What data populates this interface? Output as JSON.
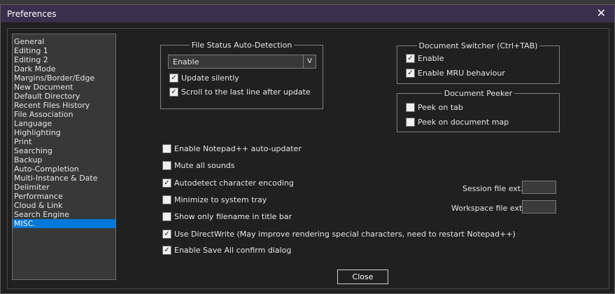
{
  "window": {
    "title": "Preferences",
    "close_glyph": "✕"
  },
  "categories": [
    "General",
    "Editing 1",
    "Editing 2",
    "Dark Mode",
    "Margins/Border/Edge",
    "New Document",
    "Default Directory",
    "Recent Files History",
    "File Association",
    "Language",
    "Highlighting",
    "Print",
    "Searching",
    "Backup",
    "Auto-Completion",
    "Multi-Instance & Date",
    "Delimiter",
    "Performance",
    "Cloud & Link",
    "Search Engine",
    "MISC."
  ],
  "selected_category": "MISC.",
  "file_status": {
    "legend": "File Status Auto-Detection",
    "select_value": "Enable",
    "select_arrow": "V",
    "update_silently": {
      "label": "Update silently",
      "checked": true
    },
    "scroll_last_line": {
      "label": "Scroll to the last line after update",
      "checked": true
    }
  },
  "doc_switcher": {
    "legend": "Document Switcher (Ctrl+TAB)",
    "enable": {
      "label": "Enable",
      "checked": true
    },
    "mru": {
      "label": "Enable MRU behaviour",
      "checked": true
    }
  },
  "doc_peeker": {
    "legend": "Document Peeker",
    "peek_tab": {
      "label": "Peek on tab",
      "checked": false
    },
    "peek_map": {
      "label": "Peek on document map",
      "checked": false
    }
  },
  "misc": {
    "auto_updater": {
      "label": "Enable Notepad++ auto-updater",
      "checked": false
    },
    "mute": {
      "label": "Mute all sounds",
      "checked": false
    },
    "autodetect_encoding": {
      "label": "Autodetect character encoding",
      "checked": true
    },
    "minimize_tray": {
      "label": "Minimize to system tray",
      "checked": false
    },
    "filename_title": {
      "label": "Show only filename in title bar",
      "checked": false
    },
    "directwrite": {
      "label": "Use DirectWrite (May improve rendering special characters, need to restart Notepad++)",
      "checked": true
    },
    "save_all_confirm": {
      "label": "Enable Save All confirm dialog",
      "checked": true
    }
  },
  "session_ext": {
    "label": "Session file ext.:",
    "value": ""
  },
  "workspace_ext": {
    "label": "Workspace file ext.:",
    "value": ""
  },
  "close_button": "Close",
  "check_glyph": "✓"
}
